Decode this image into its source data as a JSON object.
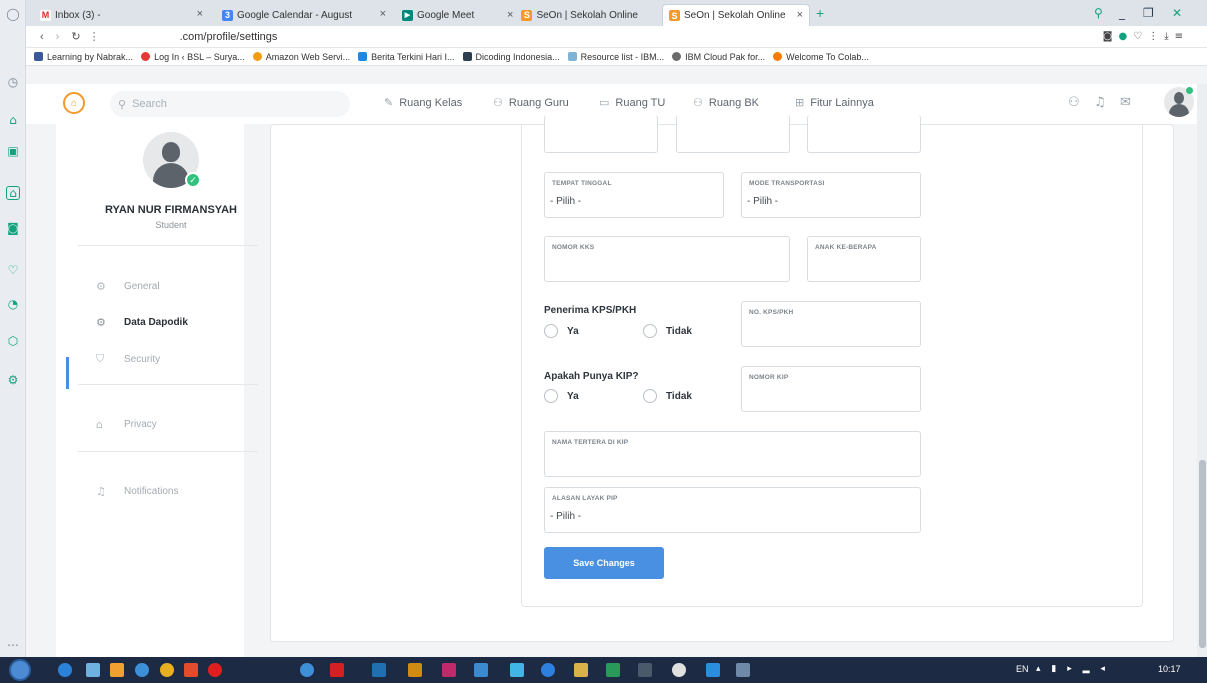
{
  "browser": {
    "tabs": [
      {
        "label": "Inbox (3) -",
        "color": "#d93025",
        "glyph": "M"
      },
      {
        "label": "Google Calendar - August",
        "color": "#4285f4",
        "glyph": "3"
      },
      {
        "label": "Google Meet",
        "color": "#00897b",
        "glyph": "▶"
      },
      {
        "label": "SeOn | Sekolah Online",
        "color": "#f39a2a",
        "glyph": "S"
      },
      {
        "label": "SeOn | Sekolah Online",
        "color": "#f39a2a",
        "glyph": "S"
      }
    ],
    "address": ".com/profile/settings",
    "bookmarks": [
      {
        "label": "Learning by Nabrak...",
        "color": "#3b5998"
      },
      {
        "label": "Log In ‹ BSL – Surya...",
        "color": "#e53935"
      },
      {
        "label": "Amazon Web Servi...",
        "color": "#f39c12"
      },
      {
        "label": "Berita Terkini Hari I...",
        "color": "#1e88e5"
      },
      {
        "label": "Dicoding Indonesia...",
        "color": "#2c3e50"
      },
      {
        "label": "Resource list - IBM...",
        "color": "#7fb3d5"
      },
      {
        "label": "IBM Cloud Pak for...",
        "color": "#6c6c6c"
      },
      {
        "label": "Welcome To Colab...",
        "color": "#f57c00"
      }
    ]
  },
  "header": {
    "search_placeholder": "Search",
    "nav": [
      {
        "label": "Ruang Kelas",
        "icon": "✎"
      },
      {
        "label": "Ruang Guru",
        "icon": "⚇"
      },
      {
        "label": "Ruang TU",
        "icon": "▭"
      },
      {
        "label": "Ruang BK",
        "icon": "⚇"
      },
      {
        "label": "Fitur Lainnya",
        "icon": "⊞"
      }
    ]
  },
  "profile": {
    "name": "RYAN NUR FIRMANSYAH",
    "role": "Student"
  },
  "sidebar": {
    "items": [
      {
        "label": "General",
        "icon": "⚙"
      },
      {
        "label": "Data Dapodik",
        "icon": "⚙"
      },
      {
        "label": "Security",
        "icon": "⛉"
      },
      {
        "label": "Privacy",
        "icon": "⌂"
      },
      {
        "label": "Notifications",
        "icon": "♫"
      }
    ]
  },
  "form": {
    "tempat_tinggal": {
      "label": "TEMPAT TINGGAL",
      "value": "- Pilih -"
    },
    "mode_transportasi": {
      "label": "MODE TRANSPORTASI",
      "value": "- Pilih -"
    },
    "nomor_kks": {
      "label": "NOMOR KKS"
    },
    "anak_ke": {
      "label": "ANAK KE-BERAPA"
    },
    "kps": {
      "question": "Penerima KPS/PKH",
      "yes": "Ya",
      "no": "Tidak",
      "field_label": "NO. KPS/PKH"
    },
    "kip": {
      "question": "Apakah Punya KIP?",
      "yes": "Ya",
      "no": "Tidak",
      "field_label": "NOMOR KIP"
    },
    "nama_kip": {
      "label": "NAMA TERTERA DI KIP"
    },
    "alasan_pip": {
      "label": "ALASAN LAYAK PIP",
      "value": "- Pilih -"
    },
    "save_label": "Save Changes"
  },
  "taskbar": {
    "lang": "EN",
    "time": "10:17"
  }
}
